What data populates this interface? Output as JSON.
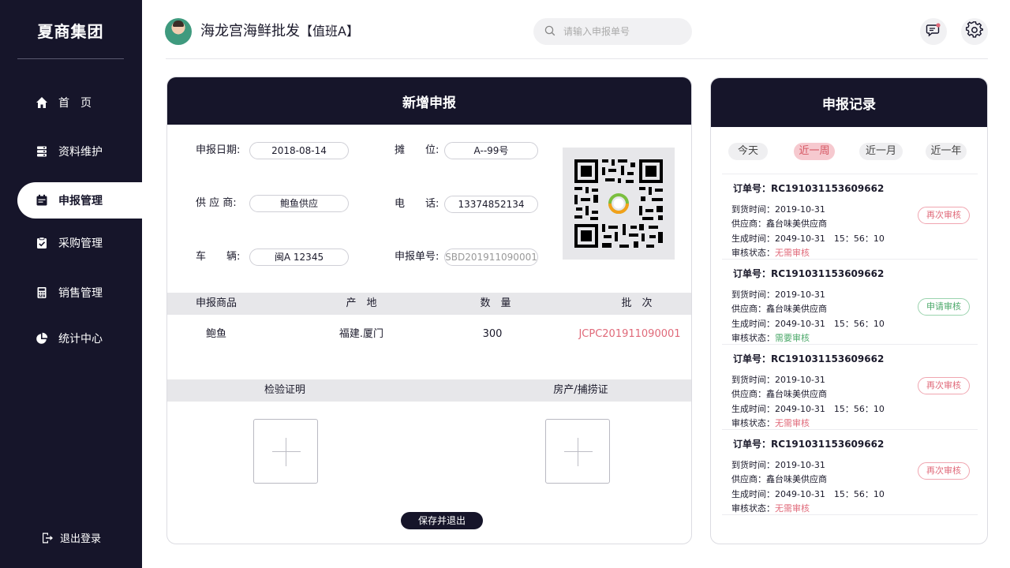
{
  "app": {
    "brand": "夏商集团"
  },
  "sidebar": {
    "items": [
      {
        "label": "首　页",
        "icon": "home-icon"
      },
      {
        "label": "资料维护",
        "icon": "database-icon"
      },
      {
        "label": "申报管理",
        "icon": "calendar-icon",
        "active": true
      },
      {
        "label": "采购管理",
        "icon": "clipboard-check-icon"
      },
      {
        "label": "销售管理",
        "icon": "calculator-icon"
      },
      {
        "label": "统计中心",
        "icon": "pie-chart-icon"
      }
    ],
    "logout": "退出登录"
  },
  "header": {
    "shop_name": "海龙宫海鲜批发",
    "shift": "【值班A】",
    "search_placeholder": "请输入申报单号"
  },
  "form": {
    "title": "新增申报",
    "fields": {
      "date_label": "申报日期:",
      "date_value": "2018-08-14",
      "stall_label": "摊　　位:",
      "stall_value": "A--99号",
      "supplier_label": "供 应 商:",
      "supplier_value": "鲍鱼供应",
      "phone_label": "电　　话:",
      "phone_value": "13374852134",
      "vehicle_label": "车　　辆:",
      "vehicle_value": "闽A 12345",
      "order_label": "申报单号:",
      "order_value": "SBD201911090001"
    },
    "table": {
      "headers": [
        "申报商品",
        "产　地",
        "数　量",
        "批　次"
      ],
      "rows": [
        [
          "鲍鱼",
          "福建.厦门",
          "300",
          "JCPC201911090001"
        ]
      ]
    },
    "attach": {
      "cert_label": "检验证明",
      "origin_label": "房产/捕捞证"
    },
    "save_label": "保存并退出"
  },
  "records": {
    "title": "申报记录",
    "filters": [
      "今天",
      "近一周",
      "近一月",
      "近一年"
    ],
    "active_filter": "近一周",
    "items": [
      {
        "order": "订单号：RC191031153609662",
        "arrive": "到货时间：2019-10-31",
        "supplier": "供应商：鑫台味美供应商",
        "created": "生成时间：2049-10-31　15：56：10",
        "status_label": "审核状态：",
        "status": "无需审核",
        "action": "再次审核"
      },
      {
        "order": "订单号：RC191031153609662",
        "arrive": "到货时间：2019-10-31",
        "supplier": "供应商：鑫台味美供应商",
        "created": "生成时间：2049-10-31　15：56：10",
        "status_label": "审核状态：",
        "status": "需要审核",
        "action": "申请审核"
      },
      {
        "order": "订单号：RC191031153609662",
        "arrive": "到货时间：2019-10-31",
        "supplier": "供应商：鑫台味美供应商",
        "created": "生成时间：2049-10-31　15：56：10",
        "status_label": "审核状态：",
        "status": "无需审核",
        "action": "再次审核"
      },
      {
        "order": "订单号：RC191031153609662",
        "arrive": "到货时间：2019-10-31",
        "supplier": "供应商：鑫台味美供应商",
        "created": "生成时间：2049-10-31　15：56：10",
        "status_label": "审核状态：",
        "status": "无需审核",
        "action": "再次审核"
      }
    ]
  },
  "colors": {
    "dark": "#16152a",
    "accent_red": "#e06a7a",
    "accent_green": "#4da96b"
  }
}
